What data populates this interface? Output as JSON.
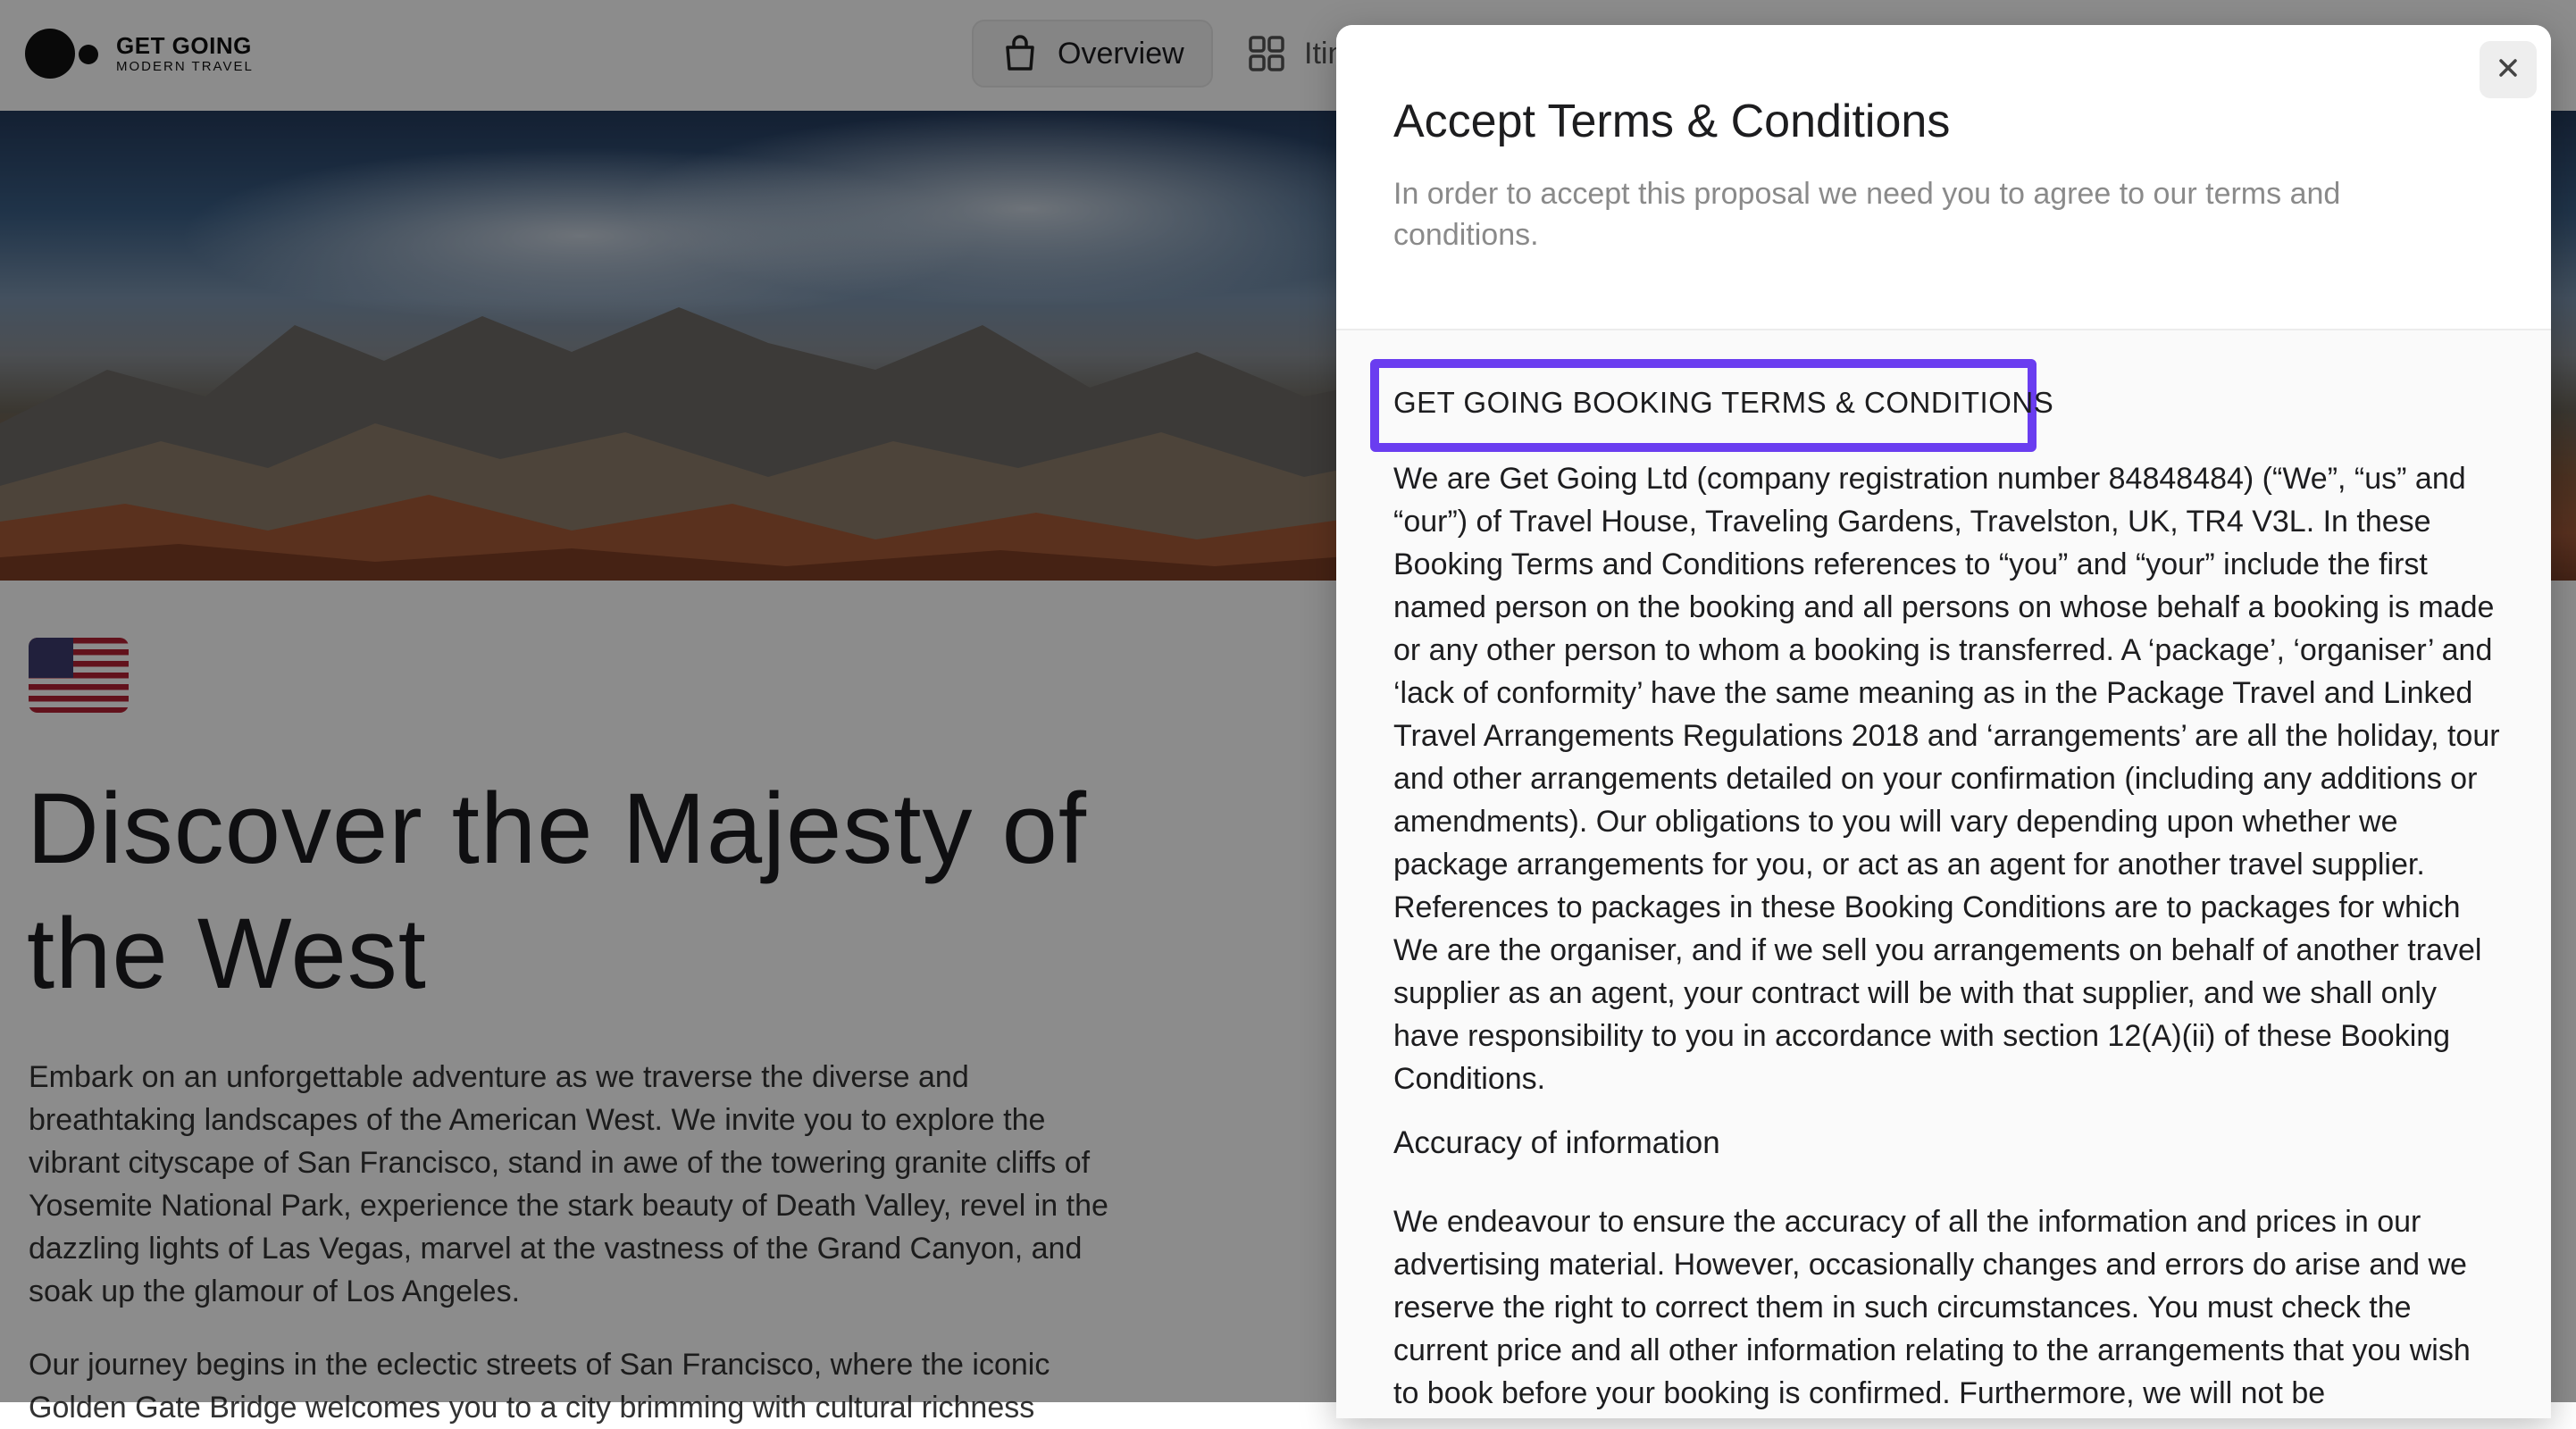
{
  "brand": {
    "name": "GET GOING",
    "tagline": "MODERN TRAVEL"
  },
  "nav": {
    "overview_label": "Overview",
    "itinerary_label_visible": "Itin"
  },
  "hero": {
    "title": "Discover the Majesty of the West",
    "paragraphs": [
      "Embark on an unforgettable adventure as we traverse the diverse and breathtaking landscapes of the American West. We invite you to explore the vibrant cityscape of San Francisco, stand in awe of the towering granite cliffs of Yosemite National Park, experience the stark beauty of Death Valley, revel in the dazzling lights of Las Vegas, marvel at the vastness of the Grand Canyon, and soak up the glamour of Los Angeles.",
      "Our journey begins in the eclectic streets of San Francisco, where the iconic Golden Gate Bridge welcomes you to a city brimming with cultural richness"
    ]
  },
  "modal": {
    "title": "Accept Terms & Conditions",
    "subtitle": "In order to accept this proposal we need you to agree to our terms and conditions.",
    "close_icon": "close-icon",
    "terms": {
      "heading": "GET GOING BOOKING TERMS & CONDITIONS",
      "paragraph1": "We are Get Going Ltd (company registration number 84848484) (“We”, “us” and “our”) of Travel House, Traveling Gardens, Travelston, UK, TR4 V3L. In these Booking Terms and Conditions references to “you” and “your” include the first named person on the booking and all persons on whose behalf a booking is made or any other person to whom a booking is transferred. A ‘package’, ‘organiser’ and ‘lack of conformity’ have the same meaning as in the Package Travel and Linked Travel Arrangements Regulations 2018 and ‘arrangements’ are all the holiday, tour and other arrangements detailed on your confirmation (including any additions or amendments). Our obligations to you will vary depending upon whether we package arrangements for you, or act as an agent for another travel supplier. References to packages in these Booking Conditions are to packages for which We are the organiser, and if we sell you arrangements on behalf of another travel supplier as an agent, your contract will be with that supplier, and we shall only have responsibility to you in accordance with section 12(A)(ii) of these Booking Conditions.",
      "subheading": "Accuracy of information",
      "paragraph2": "We endeavour to ensure the accuracy of all the information and prices in our advertising material. However, occasionally changes and errors do arise and we reserve the right to correct them in such circumstances. You must check the current price and all other information relating to the arrangements that you wish to book before your booking is confirmed. Furthermore, we will not be"
    }
  },
  "colors": {
    "highlight": "#6a3df0",
    "overlay": "rgba(0,0,0,0.45)"
  }
}
